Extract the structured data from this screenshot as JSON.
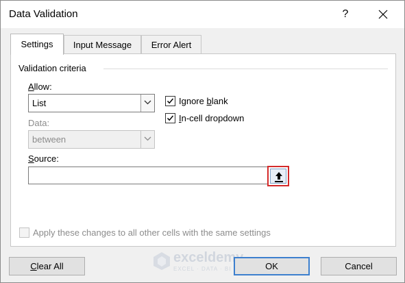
{
  "window": {
    "title": "Data Validation",
    "help_glyph": "?"
  },
  "tabs": [
    {
      "label": "Settings",
      "active": true
    },
    {
      "label": "Input Message",
      "active": false
    },
    {
      "label": "Error Alert",
      "active": false
    }
  ],
  "settings": {
    "group_label": "Validation criteria",
    "allow": {
      "label": "Allow:",
      "value": "List"
    },
    "data": {
      "label": "Data:",
      "value": "between",
      "disabled": true
    },
    "ignore_blank": {
      "label": "Ignore blank",
      "checked": true
    },
    "in_cell_dropdown": {
      "label": "In-cell dropdown",
      "checked": true
    },
    "source": {
      "label": "Source:",
      "value": ""
    },
    "apply_all": {
      "label": "Apply these changes to all other cells with the same settings",
      "checked": false,
      "disabled": true
    }
  },
  "buttons": {
    "clear_all": "Clear All",
    "ok": "OK",
    "cancel": "Cancel"
  },
  "watermark": {
    "name": "exceldemy",
    "tagline": "EXCEL · DATA · BI"
  },
  "colors": {
    "highlight_border": "#d42a2a",
    "default_button_border": "#3c7fce"
  }
}
